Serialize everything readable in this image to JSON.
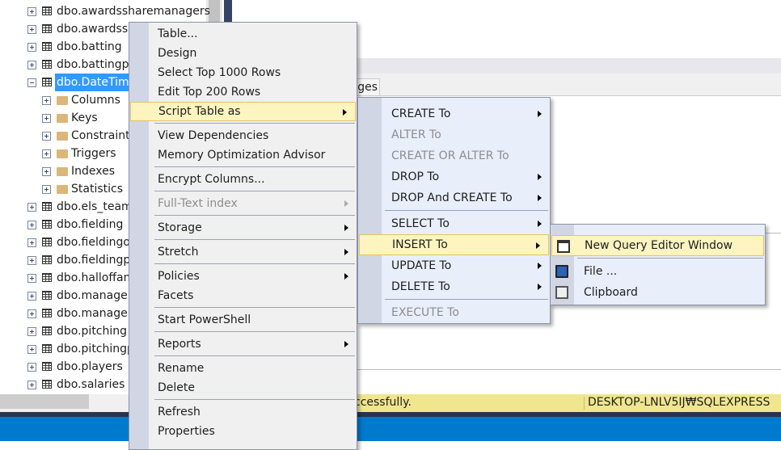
{
  "tree": {
    "items": [
      {
        "label": "dbo.awardssharemanagers",
        "type": "table",
        "level": 0
      },
      {
        "label": "dbo.awardssh",
        "type": "table",
        "level": 0
      },
      {
        "label": "dbo.batting",
        "type": "table",
        "level": 0
      },
      {
        "label": "dbo.battingp",
        "type": "table",
        "level": 0
      },
      {
        "label": "dbo.DateTim",
        "type": "table",
        "level": 0,
        "expanded": true,
        "selected": true
      },
      {
        "label": "Columns",
        "type": "folder",
        "level": 1
      },
      {
        "label": "Keys",
        "type": "folder",
        "level": 1
      },
      {
        "label": "Constraint",
        "type": "folder",
        "level": 1
      },
      {
        "label": "Triggers",
        "type": "folder",
        "level": 1
      },
      {
        "label": "Indexes",
        "type": "folder",
        "level": 1
      },
      {
        "label": "Statistics",
        "type": "folder",
        "level": 1
      },
      {
        "label": "dbo.els_team",
        "type": "table",
        "level": 0
      },
      {
        "label": "dbo.fielding",
        "type": "table",
        "level": 0
      },
      {
        "label": "dbo.fieldingo",
        "type": "table",
        "level": 0
      },
      {
        "label": "dbo.fieldingp",
        "type": "table",
        "level": 0
      },
      {
        "label": "dbo.halloffam",
        "type": "table",
        "level": 0
      },
      {
        "label": "dbo.manager",
        "type": "table",
        "level": 0
      },
      {
        "label": "dbo.manager",
        "type": "table",
        "level": 0
      },
      {
        "label": "dbo.pitching",
        "type": "table",
        "level": 0
      },
      {
        "label": "dbo.pitchingp",
        "type": "table",
        "level": 0
      },
      {
        "label": "dbo.players",
        "type": "table",
        "level": 0
      },
      {
        "label": "dbo.salaries",
        "type": "table",
        "level": 0
      }
    ]
  },
  "results_tab": {
    "label": "ges"
  },
  "status": {
    "message": "ccessfully.",
    "server": "DESKTOP-LNLV5IJ₩SQLEXPRESS ..."
  },
  "context_menu": {
    "items": [
      {
        "label": "Table..."
      },
      {
        "label": "Design"
      },
      {
        "label": "Select Top 1000 Rows"
      },
      {
        "label": "Edit Top 200 Rows"
      },
      {
        "label": "Script Table as",
        "submenu": true,
        "highlighted": true
      },
      {
        "label": "View Dependencies",
        "sep_before": true
      },
      {
        "label": "Memory Optimization Advisor"
      },
      {
        "label": "Encrypt Columns...",
        "sep_before": true
      },
      {
        "label": "Full-Text index",
        "submenu": true,
        "disabled": true,
        "sep_before": true
      },
      {
        "label": "Storage",
        "submenu": true,
        "sep_before": true
      },
      {
        "label": "Stretch",
        "submenu": true,
        "sep_before": true
      },
      {
        "label": "Policies",
        "submenu": true,
        "sep_before": true
      },
      {
        "label": "Facets"
      },
      {
        "label": "Start PowerShell",
        "sep_before": true
      },
      {
        "label": "Reports",
        "submenu": true,
        "sep_before": true
      },
      {
        "label": "Rename",
        "sep_before": true
      },
      {
        "label": "Delete"
      },
      {
        "label": "Refresh",
        "sep_before": true
      },
      {
        "label": "Properties"
      }
    ]
  },
  "script_submenu": {
    "items": [
      {
        "label": "CREATE To",
        "submenu": true
      },
      {
        "label": "ALTER To",
        "disabled": true
      },
      {
        "label": "CREATE OR ALTER To",
        "disabled": true
      },
      {
        "label": "DROP To",
        "submenu": true
      },
      {
        "label": "DROP And CREATE To",
        "submenu": true
      },
      {
        "label": "SELECT To",
        "submenu": true,
        "sep_before": true
      },
      {
        "label": "INSERT To",
        "submenu": true,
        "highlighted": true
      },
      {
        "label": "UPDATE To",
        "submenu": true
      },
      {
        "label": "DELETE To",
        "submenu": true
      },
      {
        "label": "EXECUTE To",
        "disabled": true,
        "sep_before": true
      }
    ]
  },
  "insert_submenu": {
    "items": [
      {
        "label": "New Query Editor Window",
        "icon": "new-query-icon",
        "highlighted": true
      },
      {
        "label": "File ...",
        "icon": "save-file-icon",
        "sep_before": true
      },
      {
        "label": "Clipboard",
        "icon": "clipboard-icon"
      }
    ]
  },
  "colors": {
    "highlight": "#fdf4bf",
    "status_bar": "#efe68d",
    "taskbar": "#007acc",
    "menu_gutter": "#d0d6e4",
    "submenu_bg": "#e9eefb"
  }
}
